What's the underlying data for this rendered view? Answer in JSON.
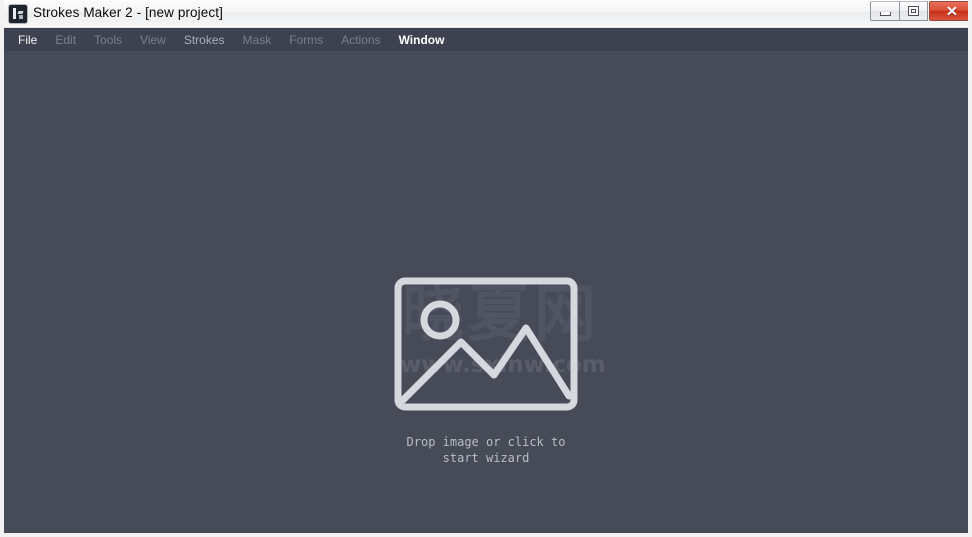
{
  "window": {
    "title": "Strokes Maker 2 - [new project]",
    "icon": "app-icon",
    "controls": {
      "minimize_label": "–",
      "maximize_label": "□",
      "close_label": "✕"
    }
  },
  "menu": {
    "items": [
      {
        "label": "File",
        "state": "enabled"
      },
      {
        "label": "Edit",
        "state": "disabled"
      },
      {
        "label": "Tools",
        "state": "disabled"
      },
      {
        "label": "View",
        "state": "disabled"
      },
      {
        "label": "Strokes",
        "state": "semi"
      },
      {
        "label": "Mask",
        "state": "disabled"
      },
      {
        "label": "Forms",
        "state": "disabled"
      },
      {
        "label": "Actions",
        "state": "disabled"
      },
      {
        "label": "Window",
        "state": "active"
      }
    ]
  },
  "canvas": {
    "drop_zone": {
      "icon": "image-placeholder-icon",
      "text": "Drop image or click to\nstart wizard"
    },
    "watermark": {
      "cjk": "晓夏网",
      "url": "www.sxinw.com"
    }
  },
  "colors": {
    "canvas_bg": "#474b58",
    "menu_bg": "#3e4250",
    "titlebar_bg": "#f4f5f6",
    "close_button": "#c8301b",
    "placeholder_stroke": "#d5d8de",
    "drop_text": "#b9bdc8"
  }
}
